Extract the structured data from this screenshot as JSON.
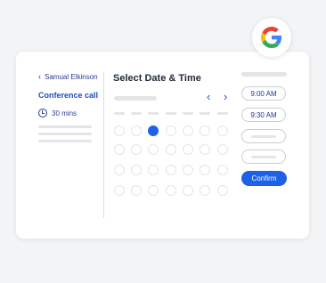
{
  "sidebar": {
    "host_name": "Samual Elkinson",
    "event_title": "Conference call",
    "duration": "30 mins"
  },
  "calendar": {
    "title": "Select Date & Time",
    "selected_day": {
      "row": 0,
      "col": 2
    }
  },
  "time_slots": [
    "9:00 AM",
    "9:30 AM"
  ],
  "confirm_label": "Confirm",
  "colors": {
    "accent": "#1e60e6",
    "text_blue": "#1e4fc2",
    "placeholder": "#e3e5e8"
  },
  "icons": [
    "chevron-left-icon",
    "clock-icon",
    "chevron-right-icon",
    "google-logo-icon"
  ]
}
